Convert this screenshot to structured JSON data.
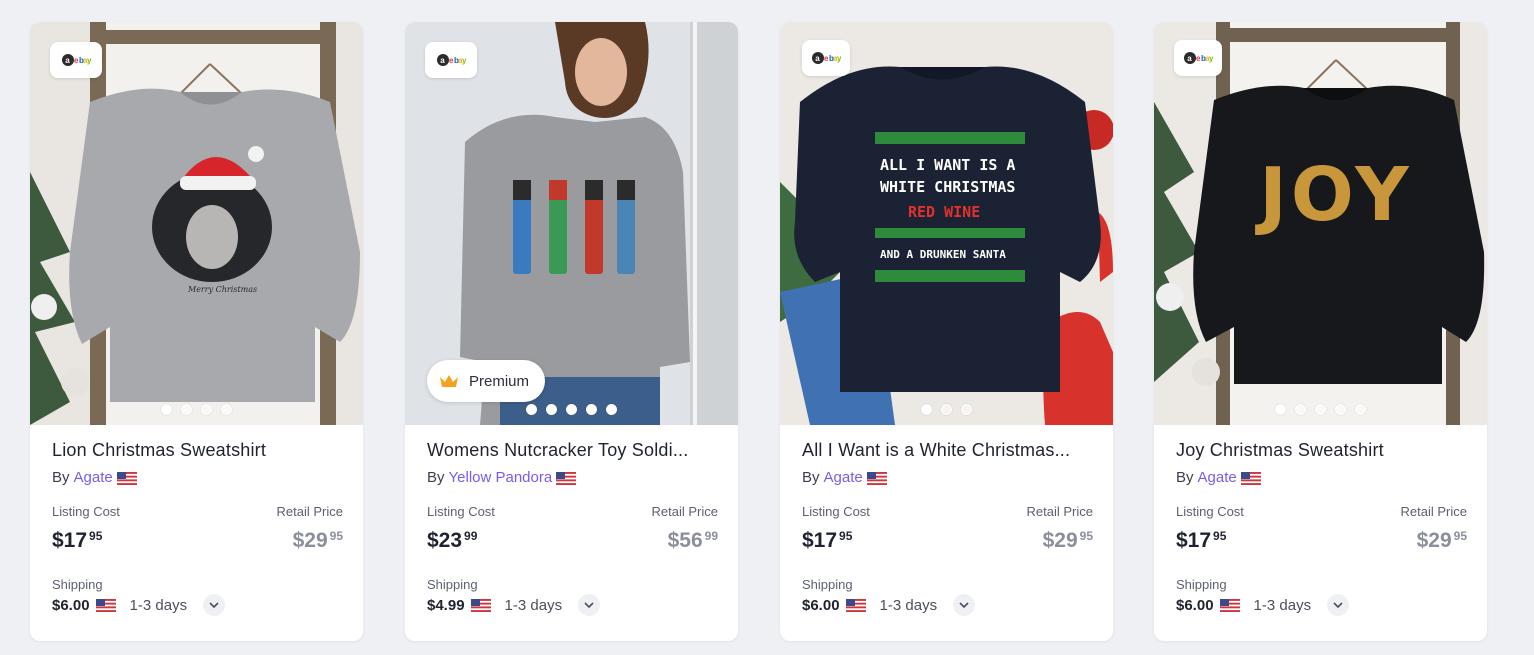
{
  "products": [
    {
      "title": "Lion Christmas Sweatshirt",
      "by_label": "By",
      "seller": "Agate",
      "listing_label": "Listing Cost",
      "listing_dollars": "$17",
      "listing_cents": "95",
      "retail_label": "Retail Price",
      "retail_dollars": "$29",
      "retail_cents": "95",
      "shipping_label": "Shipping",
      "shipping_cost": "$6.00",
      "shipping_days": "1-3 days",
      "image_dots": 4,
      "active_dot": 0
    },
    {
      "title": "Womens Nutcracker Toy Soldi...",
      "by_label": "By",
      "seller": "Yellow Pandora",
      "badge": "Premium",
      "listing_label": "Listing Cost",
      "listing_dollars": "$23",
      "listing_cents": "99",
      "retail_label": "Retail Price",
      "retail_dollars": "$56",
      "retail_cents": "99",
      "shipping_label": "Shipping",
      "shipping_cost": "$4.99",
      "shipping_days": "1-3 days",
      "image_dots": 5,
      "active_dot": 0
    },
    {
      "title": "All I Want is a White Christmas...",
      "by_label": "By",
      "seller": "Agate",
      "listing_label": "Listing Cost",
      "listing_dollars": "$17",
      "listing_cents": "95",
      "retail_label": "Retail Price",
      "retail_dollars": "$29",
      "retail_cents": "95",
      "shipping_label": "Shipping",
      "shipping_cost": "$6.00",
      "shipping_days": "1-3 days",
      "image_dots": 3,
      "active_dot": 0
    },
    {
      "title": "Joy Christmas Sweatshirt",
      "by_label": "By",
      "seller": "Agate",
      "listing_label": "Listing Cost",
      "listing_dollars": "$17",
      "listing_cents": "95",
      "retail_label": "Retail Price",
      "retail_dollars": "$29",
      "retail_cents": "95",
      "shipping_label": "Shipping",
      "shipping_cost": "$6.00",
      "shipping_days": "1-3 days",
      "image_dots": 5,
      "active_dot": 0
    }
  ],
  "print_text": {
    "lion_script": "Merry Christmas",
    "ugly_line1": "ALL I WANT IS A",
    "ugly_line2": "WHITE CHRISTMAS",
    "ugly_line3": "RED WINE",
    "ugly_line4": "AND A DRUNKEN SANTA",
    "joy": "JOY"
  },
  "colors": {
    "accent": "#7a5bf0",
    "premium_crown": "#f2a21b",
    "background": "#eef0f4"
  },
  "icons": {
    "source_badge": "marketplace-logo-icon",
    "premium": "crown-icon",
    "flag": "us-flag-icon",
    "expand": "chevron-down-icon"
  }
}
